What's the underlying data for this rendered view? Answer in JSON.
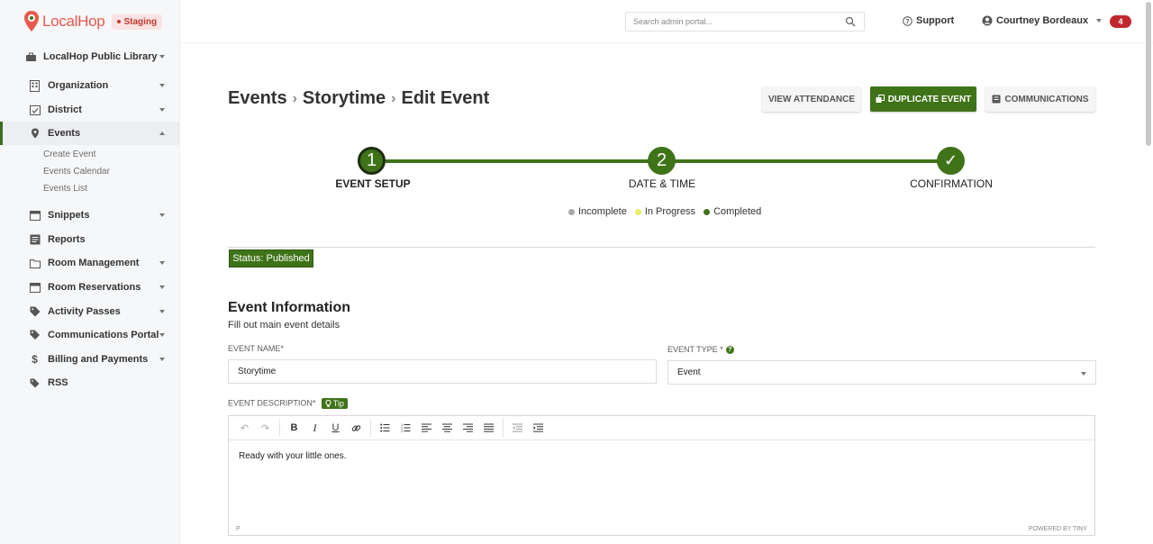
{
  "brand": {
    "name": "LocalHop",
    "env_badge": "Staging"
  },
  "org": {
    "name": "LocalHop Public Library"
  },
  "sidebar": {
    "items": [
      {
        "label": "Organization",
        "icon": "building-icon"
      },
      {
        "label": "District",
        "icon": "calendar-check-icon"
      },
      {
        "label": "Events",
        "icon": "location-pin-icon"
      },
      {
        "label": "Snippets",
        "icon": "calendar-icon"
      },
      {
        "label": "Reports",
        "icon": "report-icon"
      },
      {
        "label": "Room Management",
        "icon": "folder-icon"
      },
      {
        "label": "Room Reservations",
        "icon": "calendar-icon"
      },
      {
        "label": "Activity Passes",
        "icon": "tag-icon"
      },
      {
        "label": "Communications Portal",
        "icon": "tags-icon"
      },
      {
        "label": "Billing and Payments",
        "icon": "dollar-icon"
      },
      {
        "label": "RSS",
        "icon": "rss-icon"
      }
    ],
    "events_sub": [
      "Create Event",
      "Events Calendar",
      "Events List"
    ]
  },
  "topbar": {
    "search_placeholder": "Search admin portal...",
    "support_label": "Support",
    "user_name": "Courtney Bordeaux",
    "notification_count": "4"
  },
  "page": {
    "breadcrumb": [
      "Events",
      "Storytime",
      "Edit Event"
    ],
    "buttons": {
      "view_attendance": "VIEW ATTENDANCE",
      "duplicate_event": "DUPLICATE EVENT",
      "communications": "COMMUNICATIONS"
    }
  },
  "stepper": {
    "steps": [
      {
        "number": "1",
        "label": "EVENT SETUP"
      },
      {
        "number": "2",
        "label": "DATE & TIME"
      },
      {
        "number": "✓",
        "label": "CONFIRMATION"
      }
    ],
    "legend": [
      {
        "label": "Incomplete",
        "color": "#a9a9a9"
      },
      {
        "label": "In Progress",
        "color": "#e6ee6a"
      },
      {
        "label": "Completed",
        "color": "#3f7318"
      }
    ]
  },
  "status": "Status: Published",
  "section": {
    "title": "Event Information",
    "subtitle": "Fill out main event details"
  },
  "form": {
    "event_name_label": "EVENT NAME*",
    "event_name_value": "Storytime",
    "event_type_label": "EVENT TYPE *",
    "event_type_value": "Event",
    "event_description_label": "EVENT DESCRIPTION*",
    "tip_label": "Tip",
    "description_text": "Ready with your little ones.",
    "editor_path": "P",
    "editor_powered": "POWERED BY TINY"
  },
  "colors": {
    "accent": "#3f7318",
    "brand": "#e8584d",
    "notification": "#c0282d"
  }
}
